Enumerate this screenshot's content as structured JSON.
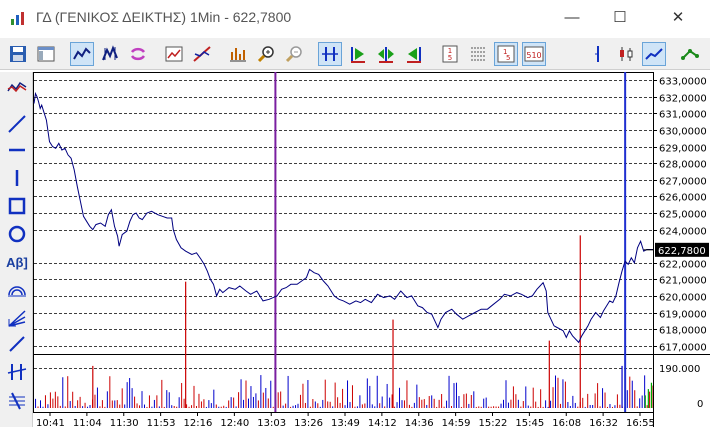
{
  "window": {
    "title": "ΓΔ (ΓΕΝΙΚΟΣ ΔΕΙΚΤΗΣ) 1Min - 622,7800",
    "minimize_glyph": "—",
    "maximize_glyph": "☐",
    "close_glyph": "✕"
  },
  "toolbar": {
    "items": [
      {
        "name": "save-icon"
      },
      {
        "name": "window-icon"
      },
      {
        "name": "line-chart-icon",
        "active": true
      },
      {
        "name": "candles-icon"
      },
      {
        "name": "refresh-icon"
      },
      {
        "name": "chart-window-icon"
      },
      {
        "name": "strike-chart-icon"
      },
      {
        "name": "indicators-icon"
      },
      {
        "name": "zoom-in-icon"
      },
      {
        "name": "zoom-out-icon"
      },
      {
        "name": "scroll-both-icon",
        "active": true
      },
      {
        "name": "scroll-right-icon"
      },
      {
        "name": "scroll-center-icon"
      },
      {
        "name": "scroll-left-icon"
      },
      {
        "name": "interval-15-icon"
      },
      {
        "name": "grid-icon"
      },
      {
        "name": "interval-1-5-icon",
        "active": true
      },
      {
        "name": "interval-5-10-icon",
        "active": true
      },
      {
        "name": "cursor-icon"
      },
      {
        "name": "ohlc-icon"
      },
      {
        "name": "line-style-icon",
        "active": true
      },
      {
        "name": "link-icon"
      }
    ]
  },
  "left_tools": [
    {
      "name": "chart-type-icon"
    },
    {
      "name": "trendline-icon"
    },
    {
      "name": "horizontal-line-icon"
    },
    {
      "name": "vertical-line-icon"
    },
    {
      "name": "rectangle-icon"
    },
    {
      "name": "ellipse-icon"
    },
    {
      "name": "text-tool-icon",
      "label": "Αβ]"
    },
    {
      "name": "arc-icon"
    },
    {
      "name": "fan-icon"
    },
    {
      "name": "line-tool-icon"
    },
    {
      "name": "cross-lines-icon"
    },
    {
      "name": "channel-icon"
    }
  ],
  "colors": {
    "price_line": "#000080",
    "volume_red": "#cc0000",
    "volume_blue": "#0000cc",
    "volume_green": "#00aa00",
    "purple_marker": "#7a1fa0",
    "blue_marker": "#1f2fd0",
    "current_bg": "#000000"
  },
  "chart_data": {
    "type": "line",
    "y_axis": {
      "ticks": [
        "633,0000",
        "632,0000",
        "631,0000",
        "630,0000",
        "629,0000",
        "628,0000",
        "627,0000",
        "626,0000",
        "625,0000",
        "624,0000",
        "622,0000",
        "621,0000",
        "620,0000",
        "619,0000",
        "618,0000",
        "617,0000"
      ],
      "tick_values": [
        633,
        632,
        631,
        630,
        629,
        628,
        627,
        626,
        625,
        624,
        622,
        621,
        620,
        619,
        618,
        617
      ],
      "range": [
        616.5,
        633.5
      ],
      "current_value": 622.78,
      "current_label": "622,7800"
    },
    "volume_axis": {
      "ticks": [
        "190.000",
        "0"
      ],
      "tick_values": [
        190000,
        0
      ]
    },
    "x_labels": [
      "10:41",
      "11:04",
      "11:30",
      "11:53",
      "12:16",
      "12:40",
      "13:03",
      "13:26",
      "13:49",
      "14:12",
      "14:36",
      "14:59",
      "15:22",
      "15:45",
      "16:08",
      "16:32",
      "16:55"
    ],
    "price": [
      [
        0,
        631.6
      ],
      [
        1,
        632.2
      ],
      [
        2,
        632.0
      ],
      [
        3,
        631.7
      ],
      [
        4,
        631.3
      ],
      [
        5,
        631.5
      ],
      [
        8,
        630.6
      ],
      [
        10,
        629.3
      ],
      [
        12,
        629.0
      ],
      [
        14,
        628.9
      ],
      [
        16,
        629.2
      ],
      [
        18,
        628.8
      ],
      [
        20,
        628.9
      ],
      [
        22,
        628.5
      ],
      [
        24,
        628.3
      ],
      [
        26,
        627.6
      ],
      [
        28,
        626.6
      ],
      [
        30,
        625.7
      ],
      [
        32,
        624.8
      ],
      [
        34,
        624.5
      ],
      [
        36,
        624.2
      ],
      [
        38,
        624.0
      ],
      [
        40,
        624.3
      ],
      [
        43,
        624.4
      ],
      [
        46,
        624.2
      ],
      [
        48,
        624.9
      ],
      [
        50,
        625.2
      ],
      [
        52,
        624.2
      ],
      [
        54,
        623.6
      ],
      [
        55,
        623.0
      ],
      [
        57,
        623.7
      ],
      [
        60,
        623.9
      ],
      [
        62,
        624.5
      ],
      [
        64,
        624.9
      ],
      [
        66,
        625.0
      ],
      [
        68,
        624.7
      ],
      [
        70,
        624.6
      ],
      [
        73,
        625.0
      ],
      [
        76,
        625.1
      ],
      [
        80,
        624.9
      ],
      [
        83,
        624.8
      ],
      [
        86,
        624.7
      ],
      [
        89,
        624.7
      ],
      [
        90,
        624.0
      ],
      [
        92,
        623.4
      ],
      [
        95,
        622.9
      ],
      [
        98,
        622.7
      ],
      [
        102,
        622.5
      ],
      [
        105,
        622.6
      ],
      [
        108,
        622.2
      ],
      [
        110,
        621.9
      ],
      [
        112,
        621.5
      ],
      [
        114,
        621.0
      ],
      [
        116,
        620.7
      ],
      [
        118,
        620.0
      ],
      [
        120,
        620.4
      ],
      [
        122,
        620.2
      ],
      [
        126,
        620.5
      ],
      [
        130,
        620.4
      ],
      [
        133,
        620.6
      ],
      [
        137,
        620.3
      ],
      [
        140,
        620.1
      ],
      [
        144,
        620.3
      ],
      [
        148,
        619.7
      ],
      [
        152,
        619.8
      ],
      [
        157,
        620.0
      ],
      [
        160,
        620.4
      ],
      [
        163,
        620.5
      ],
      [
        166,
        620.7
      ],
      [
        170,
        620.7
      ],
      [
        173,
        620.9
      ],
      [
        176,
        621.1
      ],
      [
        178,
        621.6
      ],
      [
        181,
        621.4
      ],
      [
        184,
        621.3
      ],
      [
        187,
        620.9
      ],
      [
        190,
        620.6
      ],
      [
        194,
        620.0
      ],
      [
        197,
        619.8
      ],
      [
        200,
        619.7
      ],
      [
        204,
        619.5
      ],
      [
        208,
        619.7
      ],
      [
        211,
        619.6
      ],
      [
        214,
        619.8
      ],
      [
        218,
        619.6
      ],
      [
        222,
        620.1
      ],
      [
        226,
        619.9
      ],
      [
        230,
        620.0
      ],
      [
        233,
        619.8
      ],
      [
        237,
        620.3
      ],
      [
        241,
        619.9
      ],
      [
        244,
        620.0
      ],
      [
        248,
        619.4
      ],
      [
        251,
        619.3
      ],
      [
        254,
        619.0
      ],
      [
        257,
        618.9
      ],
      [
        259,
        618.5
      ],
      [
        261,
        618.1
      ],
      [
        263,
        618.6
      ],
      [
        266,
        619.0
      ],
      [
        270,
        619.2
      ],
      [
        273,
        618.9
      ],
      [
        277,
        618.6
      ],
      [
        281,
        618.8
      ],
      [
        285,
        619.0
      ],
      [
        289,
        619.2
      ],
      [
        293,
        619.2
      ],
      [
        297,
        619.5
      ],
      [
        301,
        619.8
      ],
      [
        304,
        620.1
      ],
      [
        308,
        620.0
      ],
      [
        312,
        620.2
      ],
      [
        315,
        620.1
      ],
      [
        319,
        619.9
      ],
      [
        322,
        620.0
      ],
      [
        325,
        620.4
      ],
      [
        327,
        620.6
      ],
      [
        329,
        620.8
      ],
      [
        331,
        620.3
      ],
      [
        332,
        619.0
      ],
      [
        334,
        618.6
      ],
      [
        336,
        618.2
      ],
      [
        338,
        618.1
      ],
      [
        340,
        618.0
      ],
      [
        342,
        617.9
      ],
      [
        344,
        617.5
      ],
      [
        346,
        617.9
      ],
      [
        348,
        617.6
      ],
      [
        350,
        617.4
      ],
      [
        352,
        617.2
      ],
      [
        354,
        617.6
      ],
      [
        356,
        617.9
      ],
      [
        358,
        618.2
      ],
      [
        360,
        618.6
      ],
      [
        363,
        619.0
      ],
      [
        366,
        618.7
      ],
      [
        368,
        619.1
      ],
      [
        370,
        619.4
      ],
      [
        372,
        619.7
      ],
      [
        374,
        619.6
      ],
      [
        376,
        620.0
      ],
      [
        378,
        620.8
      ],
      [
        380,
        621.5
      ],
      [
        382,
        622.1
      ],
      [
        384,
        621.9
      ],
      [
        386,
        622.3
      ],
      [
        388,
        622.0
      ],
      [
        390,
        622.9
      ],
      [
        392,
        623.3
      ],
      [
        394,
        622.7
      ],
      [
        396,
        622.8
      ],
      [
        400,
        622.8
      ]
    ],
    "volume_spikes": [
      {
        "x": 38,
        "value": 200000,
        "color": "red"
      },
      {
        "x": 98,
        "value": 600000,
        "color": "red"
      },
      {
        "x": 232,
        "value": 420000,
        "color": "red"
      },
      {
        "x": 333,
        "value": 320000,
        "color": "red"
      },
      {
        "x": 353,
        "value": 820000,
        "color": "red"
      },
      {
        "x": 380,
        "value": 200000,
        "color": "blue"
      }
    ],
    "markers": [
      {
        "x": 156,
        "color": "purple"
      },
      {
        "x": 382,
        "color": "blue"
      }
    ],
    "xlim": [
      0,
      400
    ],
    "grid": true
  }
}
